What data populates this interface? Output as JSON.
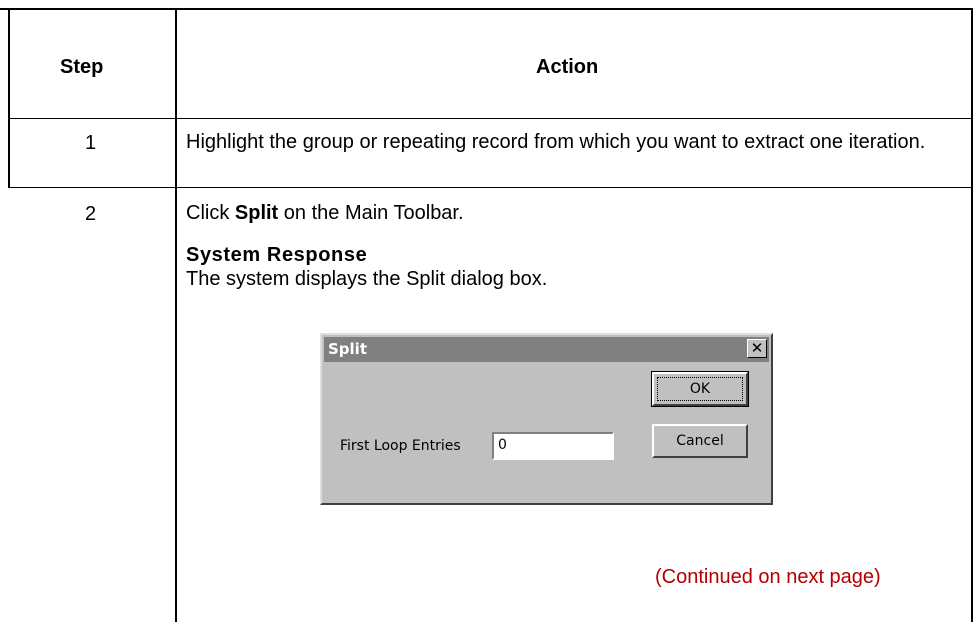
{
  "table": {
    "headers": {
      "step": "Step",
      "action": "Action"
    },
    "rows": [
      {
        "step": "1",
        "action": "Highlight the group or repeating record from which you want to extract one iteration."
      },
      {
        "step": "2",
        "action_prefix": "Click ",
        "action_bold": "Split",
        "action_suffix": " on the Main Toolbar.",
        "response_heading": "System Response",
        "response_text": "The system displays the Split dialog box."
      }
    ],
    "continued": "(Continued on next page)"
  },
  "dialog": {
    "title": "Split",
    "close_glyph": "✕",
    "field_label": "First Loop Entries",
    "field_value": "0",
    "ok_label": "OK",
    "cancel_label": "Cancel"
  },
  "colors": {
    "continued": "#b20000",
    "dialog_face": "#c0c0c0",
    "titlebar": "#808080"
  }
}
